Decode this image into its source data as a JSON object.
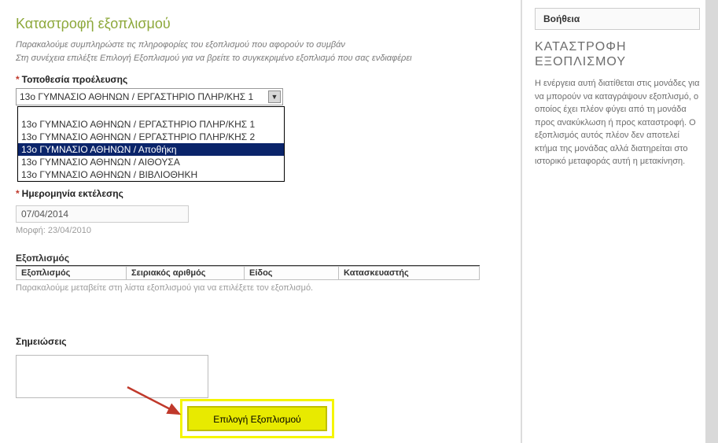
{
  "page": {
    "title": "Καταστροφή εξοπλισμού",
    "intro_line1": "Παρακαλούμε συμπληρώστε τις πληροφορίες του εξοπλισμού που αφορούν το συμβάν",
    "intro_line2": "Στη συνέχεια επιλέξτε Επιλογή Εξοπλισμού για να βρείτε το συγκεκριμένο εξοπλισμό που σας ενδιαφέρει"
  },
  "form": {
    "location_label": "Τοποθεσία προέλευσης",
    "location_value": "13ο ΓΥΜΝΑΣΙΟ ΑΘΗΝΩΝ / ΕΡΓΑΣΤΗΡΙΟ ΠΛΗΡ/ΚΗΣ 1",
    "location_options": [
      "",
      "13ο ΓΥΜΝΑΣΙΟ ΑΘΗΝΩΝ / ΕΡΓΑΣΤΗΡΙΟ ΠΛΗΡ/ΚΗΣ 1",
      "13ο ΓΥΜΝΑΣΙΟ ΑΘΗΝΩΝ / ΕΡΓΑΣΤΗΡΙΟ ΠΛΗΡ/ΚΗΣ 2",
      "13ο ΓΥΜΝΑΣΙΟ ΑΘΗΝΩΝ / Αποθήκη",
      "13ο ΓΥΜΝΑΣΙΟ ΑΘΗΝΩΝ / ΑΙΘΟΥΣΑ",
      "13ο ΓΥΜΝΑΣΙΟ ΑΘΗΝΩΝ / ΒΙΒΛΙΟΘΗΚΗ"
    ],
    "location_highlight_index": 3,
    "date_label": "Ημερομηνία εκτέλεσης",
    "date_value": "07/04/2014",
    "date_hint": "Μορφή: 23/04/2010",
    "equipment_section": "Εξοπλισμός",
    "equipment_cols": {
      "c0": "Εξοπλισμός",
      "c1": "Σειριακός αριθμός",
      "c2": "Είδος",
      "c3": "Κατασκευαστής"
    },
    "equipment_empty": "Παρακαλούμε μεταβείτε στη λίστα εξοπλισμού για να επιλέξετε τον εξοπλισμό.",
    "notes_label": "Σημειώσεις",
    "submit_label": "Επιλογή Εξοπλισμού"
  },
  "help": {
    "box_title": "Βοήθεια",
    "title": "ΚΑΤΑΣΤΡΟΦΗ ΕΞΟΠΛΙΣΜΟΥ",
    "body": "Η ενέργεια αυτή διατίθεται στις μονάδες για να μπορούν να καταγράψουν εξοπλισμό, ο οποίος έχει πλέον φύγει από τη μονάδα προς ανακύκλωση ή προς καταστροφή. Ο εξοπλισμός αυτός πλέον δεν αποτελεί κτήμα της μονάδας αλλά διατηρείται στο ιστορικό μεταφοράς αυτή η μετακίνηση."
  }
}
